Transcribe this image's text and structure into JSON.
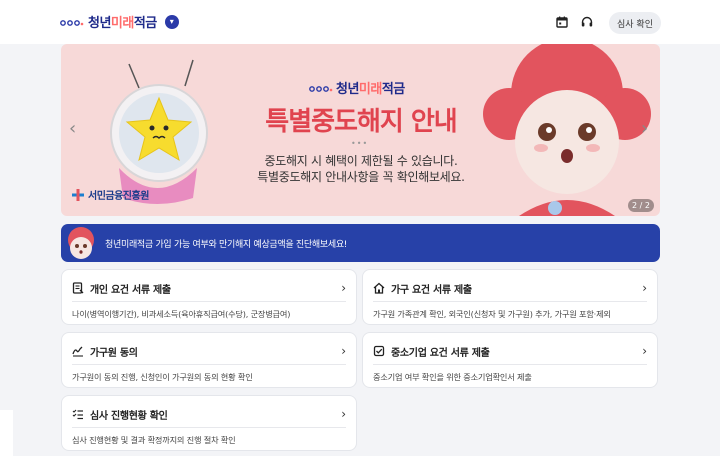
{
  "header": {
    "logo_text_a": "청년",
    "logo_text_b": "미래",
    "logo_text_c": "적금",
    "calendar_icon": "calendar-icon",
    "headset_icon": "headset-icon",
    "review_label": "심사 확인"
  },
  "banner": {
    "logo_text_a": "청년",
    "logo_text_b": "미래",
    "logo_text_c": "적금",
    "title": "특별중도해지 안내",
    "dots": "•••",
    "line1": "중도해지 시 혜택이 제한될 수 있습니다.",
    "line2": "특별중도해지 안내사항을 꼭 확인해보세요.",
    "agency": "서민금융진흥원",
    "pager": "2 / 2",
    "prev_icon": "‹",
    "next_icon": "›"
  },
  "notice": {
    "text": "청년미래적금 가입 가능 여부와 만기해지 예상금액을 진단해보세요!"
  },
  "cards": [
    {
      "title": "개인 요건 서류 제출",
      "desc": "나이(병역이행기간), 비과세소득(육아휴직급여(수당), 군장병급여)",
      "icon": "document-icon"
    },
    {
      "title": "가구 요건 서류 제출",
      "desc": "가구원 가족관계 확인, 외국인(신청자 및 가구원) 추가, 가구원 포함·제외",
      "icon": "house-icon"
    },
    {
      "title": "가구원 동의",
      "desc": "가구원이 동의 진행, 신청인이 가구원의 동의 현황 확인",
      "icon": "signature-icon"
    },
    {
      "title": "중소기업 요건 서류 제출",
      "desc": "중소기업 여부 확인을 위한 중소기업확인서 제출",
      "icon": "checkbox-icon"
    },
    {
      "title": "심사 진행현황 확인",
      "desc": "심사 진행현황 및 결과 확정까지의 진행 절차 확인",
      "icon": "checklist-icon"
    }
  ],
  "chevron": "›",
  "colors": {
    "brand_navy": "#2741a8",
    "banner_pink": "#f7d9d8",
    "title_red": "#e0444f"
  }
}
